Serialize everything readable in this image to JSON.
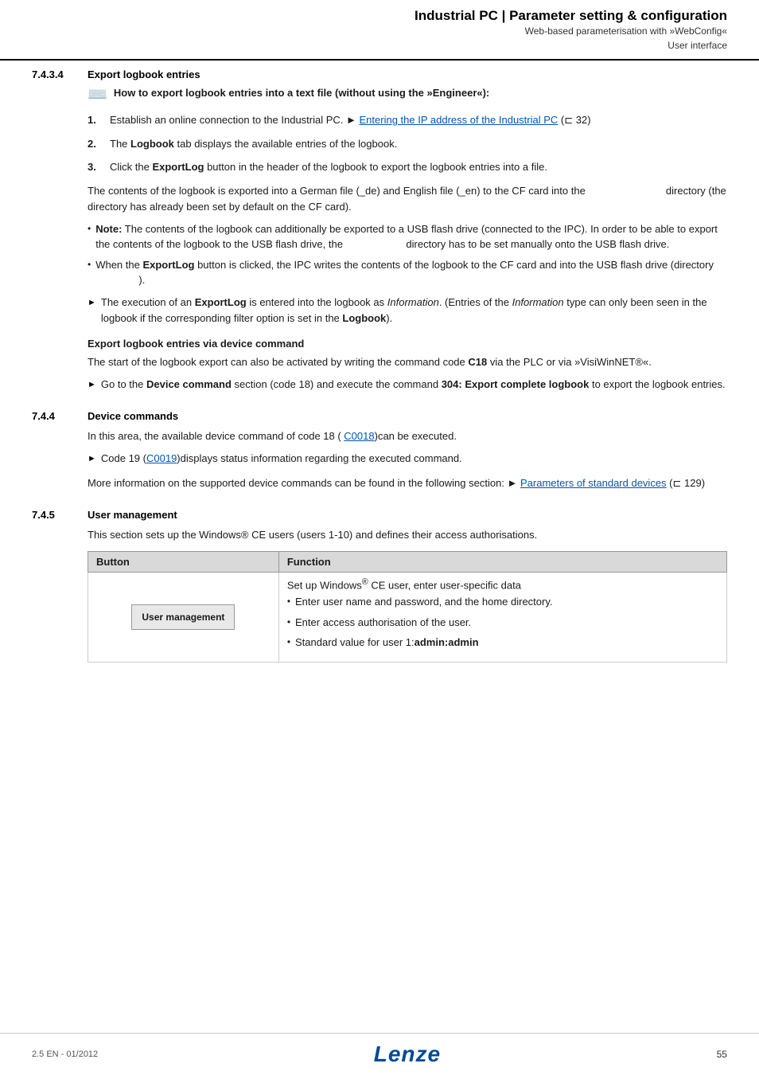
{
  "header": {
    "title": "Industrial PC | Parameter setting & configuration",
    "sub1": "Web-based parameterisation with »WebConfig«",
    "sub2": "User interface"
  },
  "section743": {
    "number": "7.4.3.4",
    "title": "Export logbook entries",
    "howto": {
      "title": "How to export logbook entries into a text file (without using the »Engineer«):"
    },
    "steps": [
      {
        "id": "step1",
        "text": "Establish an online connection to the Industrial PC.",
        "link_text": "Entering the IP address of the Industrial PC",
        "link_ref": "(⊏ 32)"
      },
      {
        "id": "step2",
        "text": "The ",
        "bold": "Logbook",
        "text2": " tab displays the available entries of the logbook."
      },
      {
        "id": "step3",
        "text": "Click the ",
        "bold": "ExportLog",
        "text2": " button in the header of the logbook to export the logbook entries into a file."
      }
    ],
    "para1": "The contents of the logbook is exported into a German file (_de) and English file (_en) to the CF card into the                                   directory (the directory has already been set by default on the CF card).",
    "notes": [
      "Note: The contents of the logbook can additionally be exported to a USB flash drive (connected to the IPC). In order to be able to export the contents of the logbook to the USB flash drive, the                          directory has to be set manually onto the USB flash drive.",
      "When the ExportLog  button is clicked, the IPC writes the contents of the logbook to the CF card and into the USB flash drive (directory                          )."
    ],
    "arrow_item": "The execution of an ExportLog is entered into the logbook as Information. (Entries of the Information type can only been seen in the logbook if the corresponding filter option is set in the Logbook).",
    "sub_title": "Export logbook entries via device command",
    "sub_para": "The start of the logbook export can also be activated by writing the command code C18 via the PLC or via »VisiWinNET®«.",
    "sub_arrow": "Go to the Device command section (code 18) and execute the command 304: Export complete logbook to export the logbook entries."
  },
  "section744": {
    "number": "7.4.4",
    "title": "Device commands",
    "para1": "In this area, the available device command of code 18 (",
    "link1_text": "C0018",
    "para1b": ")can be executed.",
    "arrow1": "Code 19 (",
    "arrow1_link": "C0019",
    "arrow1b": ")displays status information regarding the executed command.",
    "para2": "More information on the supported device commands can be found in the following section:",
    "para2_link": "Parameters of standard devices",
    "para2_ref": "(⊏ 129)"
  },
  "section745": {
    "number": "7.4.5",
    "title": "User management",
    "para1": "This section sets up the Windows® CE users (users 1-10) and defines their access authorisations.",
    "table": {
      "col1": "Button",
      "col2": "Function",
      "row1": {
        "button": "User management",
        "function_intro": "Set up Windows® CE user, enter user-specific data",
        "bullets": [
          "Enter user name and password, and the home directory.",
          "Enter access authorisation of the user.",
          "Standard value for user 1: admin:admin"
        ]
      }
    }
  },
  "footer": {
    "edition": "2.5 EN - 01/2012",
    "logo": "Lenze",
    "page": "55"
  }
}
